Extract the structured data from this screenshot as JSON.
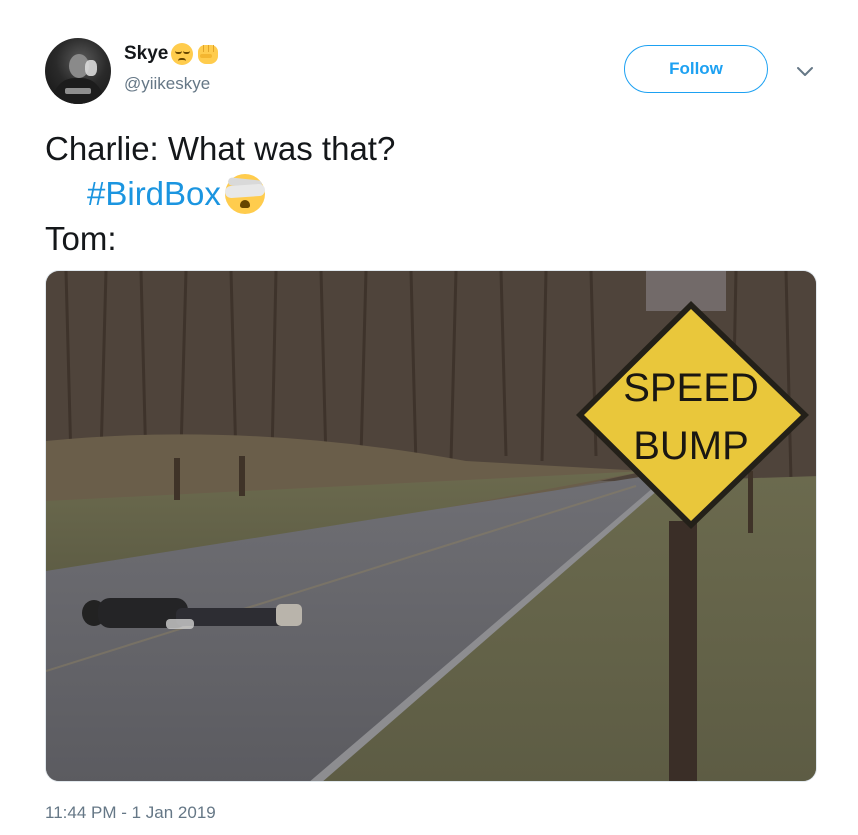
{
  "user": {
    "display_name": "Skye",
    "handle": "@yiikeskye",
    "name_emojis": [
      "pensive-face-icon",
      "raised-fist-icon"
    ]
  },
  "actions": {
    "follow_label": "Follow"
  },
  "tweet": {
    "lines": [
      "Charlie: What was that?",
      "#BirdBox",
      "Tom:"
    ],
    "hashtag_emoji": "face-with-head-bandage-icon",
    "timestamp": "11:44 PM - 1 Jan 2019"
  },
  "media": {
    "sign_text_line1": "SPEED",
    "sign_text_line2": "BUMP"
  },
  "colors": {
    "link_blue": "#1b95e0",
    "follow_blue": "#1da1f2",
    "secondary_text": "#657786",
    "sign_yellow": "#e9c73b"
  }
}
